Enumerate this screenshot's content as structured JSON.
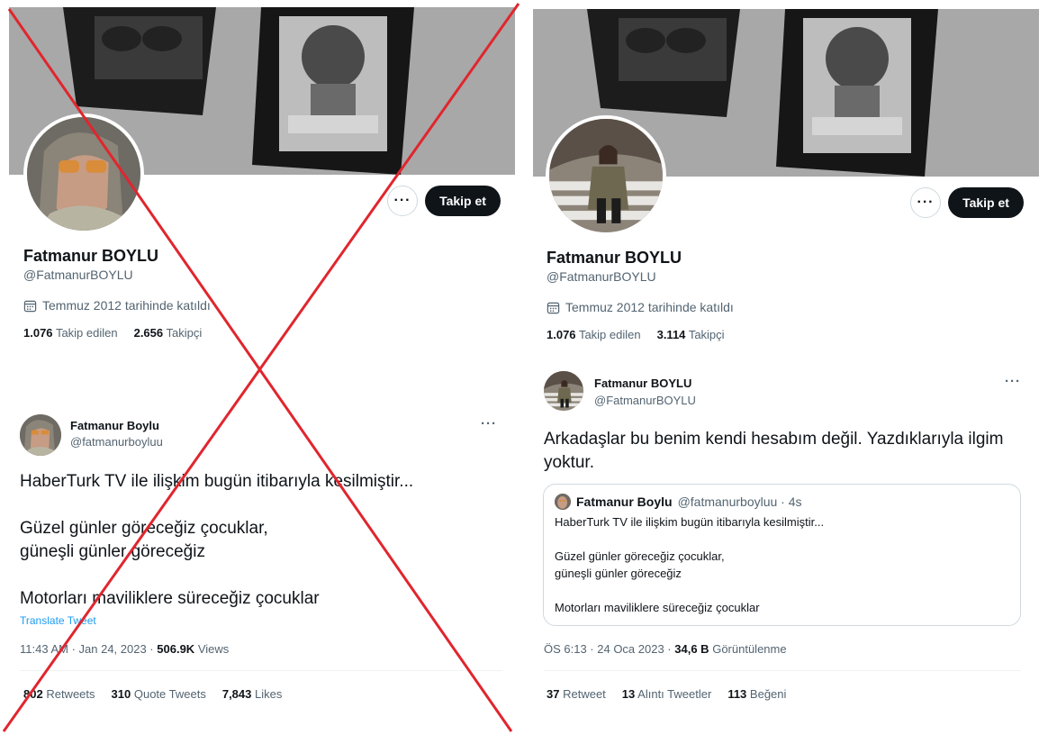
{
  "left_profile": {
    "follow_label": "Takip et",
    "more_label": "···",
    "name": "Fatmanur BOYLU",
    "handle": "@FatmanurBOYLU",
    "joined": "Temmuz 2012 tarihinde katıldı",
    "following_count": "1.076",
    "following_label": "Takip edilen",
    "followers_count": "2.656",
    "followers_label": "Takipçi"
  },
  "right_profile": {
    "follow_label": "Takip et",
    "more_label": "···",
    "name": "Fatmanur BOYLU",
    "handle": "@FatmanurBOYLU",
    "joined": "Temmuz 2012 tarihinde katıldı",
    "following_count": "1.076",
    "following_label": "Takip edilen",
    "followers_count": "3.114",
    "followers_label": "Takipçi"
  },
  "left_tweet": {
    "name": "Fatmanur Boylu",
    "handle": "@fatmanurboyluu",
    "more_label": "···",
    "line1": "HaberTurk TV ile ilişkim bugün itibarıyla kesilmiştir...",
    "line2": "Güzel günler göreceğiz çocuklar,",
    "line3": "güneşli günler göreceğiz",
    "line4": "Motorları maviliklere süreceğiz çocuklar",
    "translate": "Translate Tweet",
    "time": "11:43 AM · Jan 24, 2023 ·",
    "views_count": "506.9K",
    "views_label": "Views",
    "retweets_count": "802",
    "retweets_label": "Retweets",
    "quotes_count": "310",
    "quotes_label": "Quote Tweets",
    "likes_count": "7,843",
    "likes_label": "Likes"
  },
  "right_tweet": {
    "name": "Fatmanur BOYLU",
    "handle": "@FatmanurBOYLU",
    "more_label": "···",
    "text": "Arkadaşlar bu benim kendi hesabım değil. Yazdıklarıyla ilgim yoktur.",
    "quote": {
      "name": "Fatmanur Boylu",
      "handle": "@fatmanurboyluu · 4s",
      "line1": "HaberTurk TV ile ilişkim bugün itibarıyla kesilmiştir...",
      "line2": "Güzel günler göreceğiz çocuklar,",
      "line3": "güneşli günler göreceğiz",
      "line4": "Motorları maviliklere süreceğiz çocuklar"
    },
    "time": "ÖS 6:13 · 24 Oca 2023 ·",
    "views_count": "34,6 B",
    "views_label": "Görüntülenme",
    "retweets_count": "37",
    "retweets_label": "Retweet",
    "quotes_count": "13",
    "quotes_label": "Alıntı Tweetler",
    "likes_count": "113",
    "likes_label": "Beğeni"
  },
  "colors": {
    "cross": "#e0262e",
    "link": "#1d9bf0",
    "button_dark": "#0f1419",
    "muted": "#536471"
  }
}
